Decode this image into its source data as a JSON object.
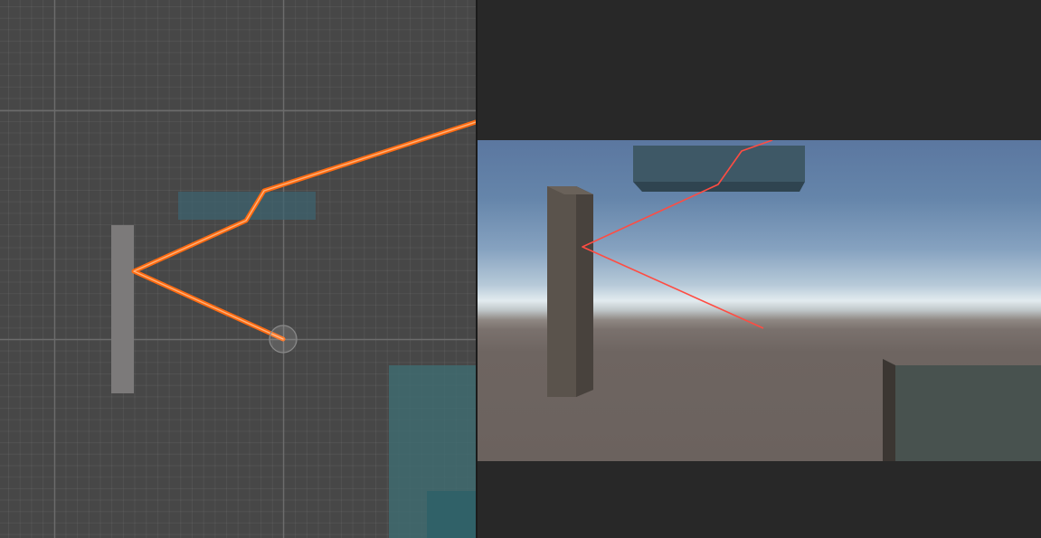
{
  "panels": {
    "scene": {
      "name": "scene-view"
    },
    "game": {
      "name": "game-view"
    }
  },
  "colors": {
    "scene_background": "#474747",
    "scene_grid_major": "#6c6c6c",
    "laser_orange": "#ff6a10",
    "laser_core": "#ffb27a",
    "laser_game_red": "#ff4c42",
    "wall_scene": "#7c7a7a",
    "platform_scene": "#3c6470",
    "obstacle_scene": "#3f6d72",
    "letterbox": "#282828",
    "pillar_front": "#5a534c",
    "pillar_side": "#48423d",
    "platform_game": "#3e5866",
    "block_game": "#48524f",
    "ground": "#6b625e"
  },
  "icons": {
    "origin_gizmo": "circle-gizmo-icon"
  }
}
